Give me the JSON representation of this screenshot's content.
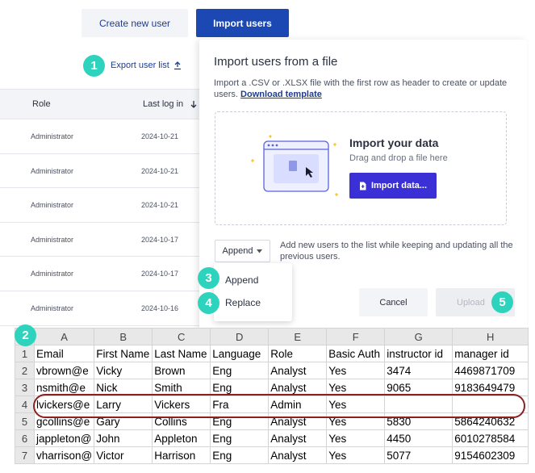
{
  "toolbar": {
    "create_label": "Create new user",
    "import_label": "Import users",
    "export_label": "Export user list"
  },
  "badges": {
    "b1": "1",
    "b2": "2",
    "b3": "3",
    "b4": "4",
    "b5": "5"
  },
  "users_table": {
    "columns": [
      "Role",
      "Last log in"
    ],
    "rows": [
      {
        "role": "Administrator",
        "last": "2024-10-21"
      },
      {
        "role": "Administrator",
        "last": "2024-10-21"
      },
      {
        "role": "Administrator",
        "last": "2024-10-21"
      },
      {
        "role": "Administrator",
        "last": "2024-10-17"
      },
      {
        "role": "Administrator",
        "last": "2024-10-17"
      },
      {
        "role": "Administrator",
        "last": "2024-10-16"
      }
    ]
  },
  "import_panel": {
    "title": "Import users from a file",
    "desc": "Import a .CSV or .XLSX file with the first row as header to create or update users.",
    "download_link": "Download template",
    "dz_title": "Import your data",
    "dz_sub": "Drag and drop a file here",
    "dz_button": "Import data...",
    "mode_value": "Append",
    "mode_desc": "Add new users to the list while keeping and updating all the previous users.",
    "menu": [
      "Append",
      "Replace"
    ],
    "cancel": "Cancel",
    "upload": "Upload"
  },
  "spreadsheet": {
    "columns": [
      "A",
      "B",
      "C",
      "D",
      "E",
      "F",
      "G",
      "H"
    ],
    "rows": [
      [
        "Email",
        "First Name",
        "Last Name",
        "Language",
        "Role",
        "Basic Auth",
        "instructor id",
        "manager id"
      ],
      [
        "vbrown@e",
        "Vicky",
        "Brown",
        "Eng",
        "Analyst",
        "Yes",
        "3474",
        "4469871709"
      ],
      [
        "nsmith@e",
        "Nick",
        "Smith",
        "Eng",
        "Analyst",
        "Yes",
        "9065",
        "9183649479"
      ],
      [
        "lvickers@e",
        "Larry",
        "Vickers",
        "Fra",
        "Admin",
        "Yes",
        "",
        ""
      ],
      [
        "gcollins@e",
        "Gary",
        "Collins",
        "Eng",
        "Analyst",
        "Yes",
        "5830",
        "5864240632"
      ],
      [
        "jappleton@",
        "John",
        "Appleton",
        "Eng",
        "Analyst",
        "Yes",
        "4450",
        "6010278584"
      ],
      [
        "vharrison@",
        "Victor",
        "Harrison",
        "Eng",
        "Analyst",
        "Yes",
        "5077",
        "9154602309"
      ]
    ]
  },
  "colors": {
    "primary": "#1b48b3",
    "badge": "#2ed3bd",
    "import_button": "#3a30d6",
    "highlight": "#8c1f1f"
  }
}
